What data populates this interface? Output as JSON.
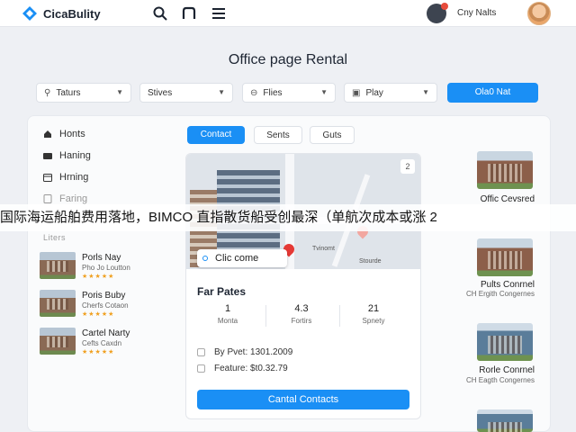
{
  "header": {
    "brand": "CicaBulity",
    "user_name": "Cny Nalts"
  },
  "page": {
    "title": "Office page Rental"
  },
  "filters": [
    {
      "icon": "⚲",
      "label": "Taturs"
    },
    {
      "icon": "",
      "label": "Stives"
    },
    {
      "icon": "⊖",
      "label": "Flies"
    },
    {
      "icon": "▣",
      "label": "Play"
    }
  ],
  "primary_button": "Ola0 Nat",
  "sidebar": {
    "items": [
      {
        "label": "Honts"
      },
      {
        "label": "Haning"
      },
      {
        "label": "Hrning"
      },
      {
        "label": "Faring"
      }
    ],
    "section": "Liters",
    "listings": [
      {
        "title": "Porls Nay",
        "sub": "Pho Jo Loutton",
        "rating": "★★★★★"
      },
      {
        "title": "Poris Buby",
        "sub": "Cherfs Cotaon",
        "rating": "★★★★★"
      },
      {
        "title": "Cartel Narty",
        "sub": "Cefts Caxdn",
        "rating": "★★★★★"
      }
    ]
  },
  "tabs": [
    {
      "label": "Contact",
      "active": true
    },
    {
      "label": "Sents",
      "active": false
    },
    {
      "label": "Guts",
      "active": false
    }
  ],
  "card": {
    "expand_label": "2",
    "cta_bubble": "Clic come",
    "map_labels": [
      "Tvinomt",
      "Stourde"
    ],
    "title": "Far Pates",
    "stats": [
      {
        "value": "1",
        "label": "Monta"
      },
      {
        "value": "4.3",
        "label": "Fortirs"
      },
      {
        "value": "21",
        "label": "Spnety"
      }
    ],
    "checks": [
      {
        "label": "By Pvet: 1301.2009"
      },
      {
        "label": "Feature: $t0.32.79"
      }
    ],
    "button": "Cantal Contacts"
  },
  "right_list": [
    {
      "title": "Offic Cevsred",
      "sub": ""
    },
    {
      "title": "Pults Conrnel",
      "sub": "CH Ergith Congernes"
    },
    {
      "title": "Rorle Conrnel",
      "sub": "CH Eagth Congernes"
    }
  ],
  "banner": "国际海运船舶费用落地，BIMCO 直指散货船受创最深（单航次成本或涨 2",
  "colors": {
    "accent": "#1a8ff5",
    "pin_red": "#e53935",
    "star": "#f0a020"
  }
}
